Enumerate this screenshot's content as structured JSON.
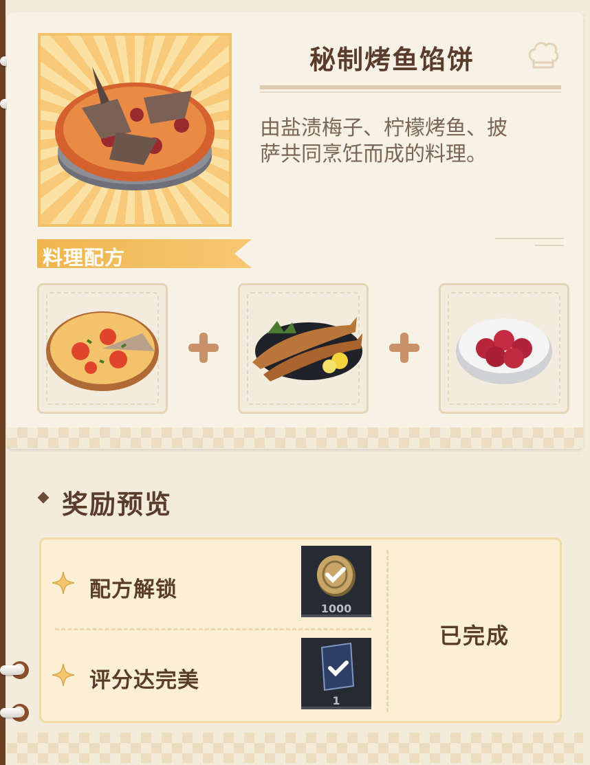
{
  "recipe": {
    "title": "秘制烤鱼馅饼",
    "description_line1": "由盐渍梅子、柠檬烤鱼、披",
    "description_line2": "萨共同烹饪而成的料理。",
    "section_label": "料理配方",
    "dish_icon": "fish-pie-icon",
    "ingredients": [
      {
        "icon": "pizza-icon"
      },
      {
        "icon": "grilled-fish-icon"
      },
      {
        "icon": "salted-plum-icon"
      }
    ]
  },
  "rewards": {
    "heading": "奖励预览",
    "items": [
      {
        "label": "配方解锁",
        "item_icon": "coin-icon",
        "quantity": "1000"
      },
      {
        "label": "评分达完美",
        "item_icon": "card-icon",
        "quantity": "1"
      }
    ],
    "status": "已完成"
  },
  "colors": {
    "accent": "#f0b54f",
    "title_text": "#5a3c2c",
    "binder": "#6b3f22"
  }
}
